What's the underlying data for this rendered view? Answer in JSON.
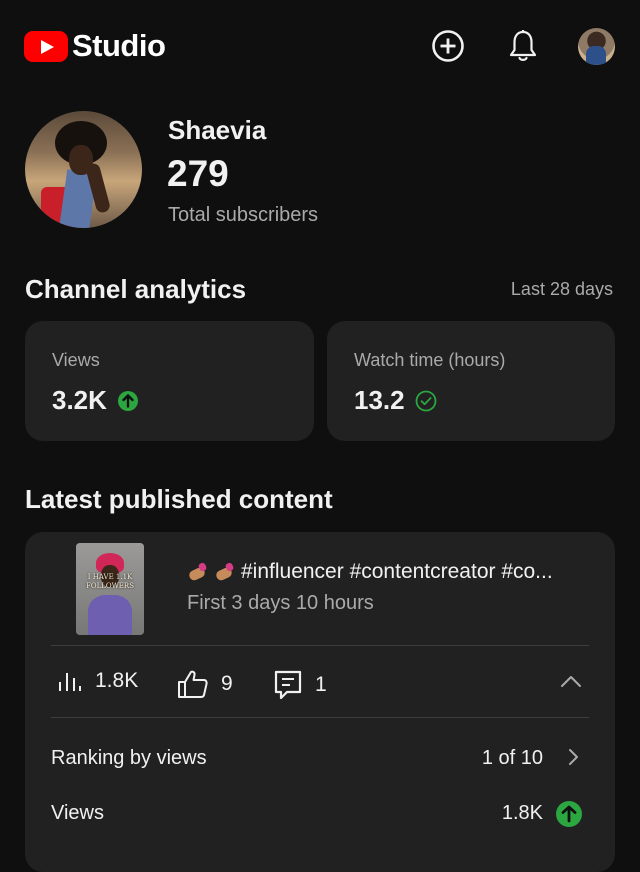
{
  "header": {
    "logo_text": "Studio",
    "create_icon": "plus-circle-icon",
    "notifications_icon": "bell-icon"
  },
  "channel": {
    "name": "Shaevia",
    "subscribers": "279",
    "subscribers_label": "Total subscribers"
  },
  "analytics": {
    "title": "Channel analytics",
    "period": "Last 28 days",
    "cards": [
      {
        "label": "Views",
        "value": "3.2K",
        "status_icon": "arrow-up-circle-icon",
        "status_color": "#2ba640"
      },
      {
        "label": "Watch time (hours)",
        "value": "13.2",
        "status_icon": "check-circle-icon",
        "status_color": "#2ba640"
      }
    ]
  },
  "latest": {
    "title": "Latest published content",
    "video": {
      "title": "#influencer #contentcreator #co...",
      "subtitle": "First 3 days 10 hours",
      "thumbnail_text": "I HAVE 1.1K FOLLOWERS",
      "views": "1.8K",
      "likes": "9",
      "comments": "1"
    },
    "rows": [
      {
        "label": "Ranking by views",
        "value": "1 of 10",
        "icon": "chevron-right-icon"
      },
      {
        "label": "Views",
        "value": "1.8K",
        "icon": "arrow-up-circle-icon"
      }
    ]
  },
  "colors": {
    "background": "#0f0f0f",
    "card": "#212121",
    "brand_red": "#ff0000",
    "positive_green": "#2ba640",
    "secondary_text": "#aaaaaa"
  }
}
